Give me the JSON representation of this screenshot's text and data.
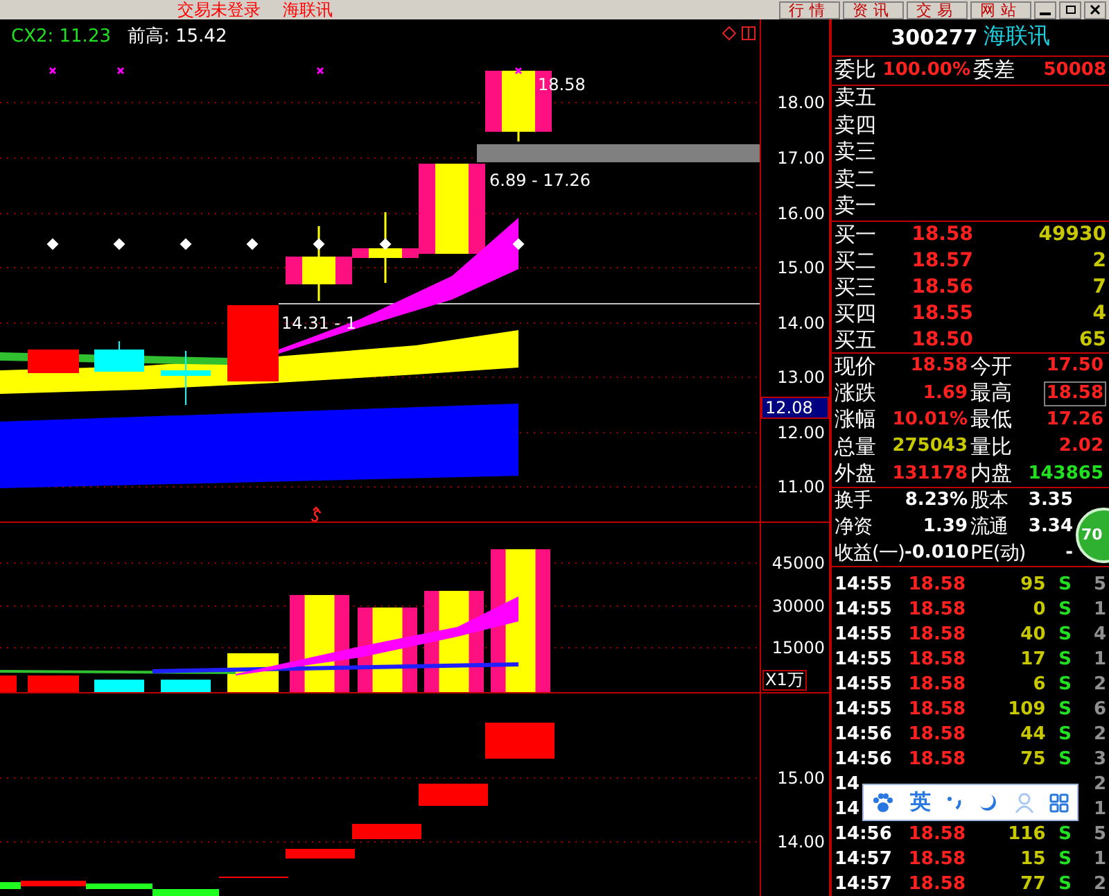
{
  "title_bar": {
    "title": "交易未登录",
    "stock": "海联讯",
    "buttons": [
      "行情",
      "资讯",
      "交易",
      "网站"
    ]
  },
  "chart": {
    "indicator": "CX2: 11.23",
    "prev_high": "前高: 15.42",
    "labels": [
      "18.58",
      "6.89 - 17.26",
      "14.31 - 1"
    ],
    "price_axis": [
      "18.00",
      "17.00",
      "16.00",
      "15.00",
      "14.00",
      "13.00",
      "12.00",
      "11.00"
    ],
    "current_price": "12.08",
    "volume_axis": [
      "45000",
      "30000",
      "15000"
    ],
    "volume_unit": "X1万",
    "lower_axis": [
      "15.00",
      "14.00"
    ]
  },
  "quote": {
    "code": "300277",
    "name": "海联讯",
    "ratio_label": "委比",
    "ratio": "100.00%",
    "diff_label": "委差",
    "diff": "50008",
    "sell": [
      "卖五",
      "卖四",
      "卖三",
      "卖二",
      "卖一"
    ],
    "buy": [
      {
        "label": "买一",
        "price": "18.58",
        "volume": "49930"
      },
      {
        "label": "买二",
        "price": "18.57",
        "volume": "2"
      },
      {
        "label": "买三",
        "price": "18.56",
        "volume": "7"
      },
      {
        "label": "买四",
        "price": "18.55",
        "volume": "4"
      },
      {
        "label": "买五",
        "price": "18.50",
        "volume": "65"
      }
    ],
    "stats": [
      {
        "label": "现价",
        "value": "18.58",
        "color": "#ff2020",
        "boxed": false
      },
      {
        "label": "今开",
        "value": "17.50",
        "color": "#ff2020",
        "boxed": false
      },
      {
        "label": "涨跌",
        "value": "1.69",
        "color": "#ff2020",
        "boxed": false
      },
      {
        "label": "最高",
        "value": "18.58",
        "color": "#ff2020",
        "boxed": true
      },
      {
        "label": "涨幅",
        "value": "10.01%",
        "color": "#ff2020",
        "boxed": false
      },
      {
        "label": "最低",
        "value": "17.26",
        "color": "#ff2020",
        "boxed": false
      },
      {
        "label": "总量",
        "value": "275043",
        "color": "#c8c800",
        "boxed": false
      },
      {
        "label": "量比",
        "value": "2.02",
        "color": "#ff2020",
        "boxed": false
      },
      {
        "label": "外盘",
        "value": "131178",
        "color": "#ff2020",
        "boxed": false
      },
      {
        "label": "内盘",
        "value": "143865",
        "color": "#20e020",
        "boxed": false
      }
    ],
    "info": [
      {
        "label": "换手",
        "value": "8.23%"
      },
      {
        "label": "股本",
        "value": "3.35"
      },
      {
        "label": "净资",
        "value": "1.39"
      },
      {
        "label": "流通",
        "value": "3.34"
      },
      {
        "label": "收益(一)",
        "value": "-0.010"
      },
      {
        "label": "PE(动)",
        "value": "-"
      }
    ],
    "ticks": [
      {
        "time": "14:55",
        "price": "18.58",
        "volume": "95",
        "side": "S",
        "count": "5"
      },
      {
        "time": "14:55",
        "price": "18.58",
        "volume": "0",
        "side": "S",
        "count": "1"
      },
      {
        "time": "14:55",
        "price": "18.58",
        "volume": "40",
        "side": "S",
        "count": "4"
      },
      {
        "time": "14:55",
        "price": "18.58",
        "volume": "17",
        "side": "S",
        "count": "1"
      },
      {
        "time": "14:55",
        "price": "18.58",
        "volume": "6",
        "side": "S",
        "count": "2"
      },
      {
        "time": "14:55",
        "price": "18.58",
        "volume": "109",
        "side": "S",
        "count": "6"
      },
      {
        "time": "14:56",
        "price": "18.58",
        "volume": "44",
        "side": "S",
        "count": "2"
      },
      {
        "time": "14:56",
        "price": "18.58",
        "volume": "75",
        "side": "S",
        "count": "3"
      },
      {
        "time": "14",
        "count": "2"
      },
      {
        "time": "14",
        "count": "1"
      },
      {
        "time": "14:56",
        "price": "18.58",
        "volume": "116",
        "side": "S",
        "count": "5"
      },
      {
        "time": "14:57",
        "price": "18.58",
        "volume": "15",
        "side": "S",
        "count": "1"
      },
      {
        "time": "14:57",
        "price": "18.58",
        "volume": "77",
        "side": "S",
        "count": "2"
      }
    ]
  },
  "ime_bar": {
    "mode": "英"
  },
  "badge": "70"
}
